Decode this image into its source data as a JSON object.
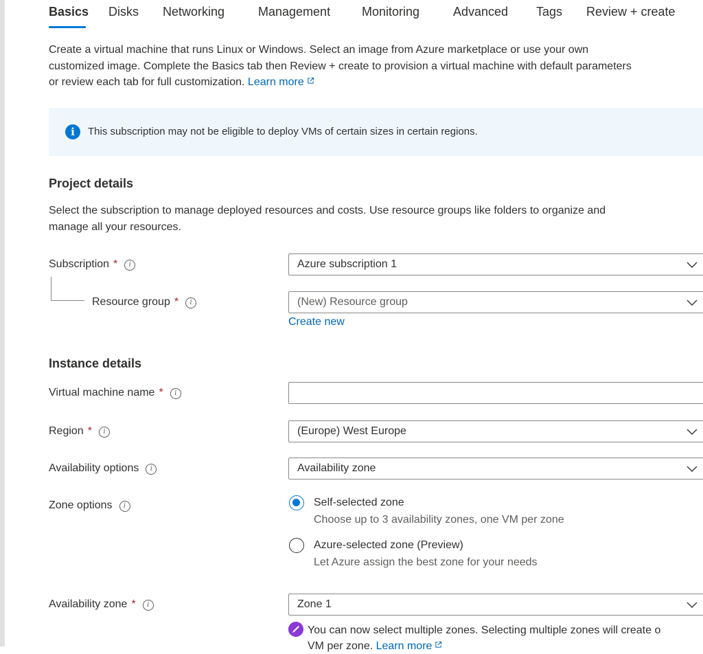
{
  "tabs": [
    {
      "label": "Basics",
      "active": true
    },
    {
      "label": "Disks"
    },
    {
      "label": "Networking"
    },
    {
      "label": "Management"
    },
    {
      "label": "Monitoring"
    },
    {
      "label": "Advanced"
    },
    {
      "label": "Tags"
    },
    {
      "label": "Review + create"
    }
  ],
  "intro": {
    "line1": "Create a virtual machine that runs Linux or Windows. Select an image from Azure marketplace or use your own",
    "line2": "customized image. Complete the Basics tab then Review + create to provision a virtual machine with default parameters",
    "line3": "or review each tab for full customization.",
    "learn_more": "Learn more"
  },
  "info_banner": {
    "text": "This subscription may not be eligible to deploy VMs of certain sizes in certain regions.",
    "icon": "info-icon"
  },
  "project": {
    "title": "Project details",
    "desc_line1": "Select the subscription to manage deployed resources and costs. Use resource groups like folders to organize and",
    "desc_line2": "manage all your resources.",
    "subscription_label": "Subscription",
    "subscription_value": "Azure subscription 1",
    "resource_group_label": "Resource group",
    "resource_group_value": "(New) Resource group",
    "create_new": "Create new"
  },
  "instance": {
    "title": "Instance details",
    "vm_name_label": "Virtual machine name",
    "vm_name_value": "",
    "region_label": "Region",
    "region_value": "(Europe) West Europe",
    "availability_options_label": "Availability options",
    "availability_options_value": "Availability zone",
    "zone_options_label": "Zone options",
    "zone_option_1": "Self-selected zone",
    "zone_option_1_desc": "Choose up to 3 availability zones, one VM per zone",
    "zone_option_2": "Azure-selected zone (Preview)",
    "zone_option_2_desc": "Let Azure assign the best zone for your needs",
    "availability_zone_label": "Availability zone",
    "availability_zone_value": "Zone 1",
    "notice_line1": "You can now select multiple zones. Selecting multiple zones will create o",
    "notice_line2": "VM per zone.",
    "notice_learn_more": "Learn more"
  },
  "required_marker": "*",
  "colors": {
    "accent": "#0078d4",
    "link": "#0067b8",
    "required": "#a4262c",
    "info_bg": "#eff6fc",
    "notice_icon": "#8a3bd6"
  }
}
